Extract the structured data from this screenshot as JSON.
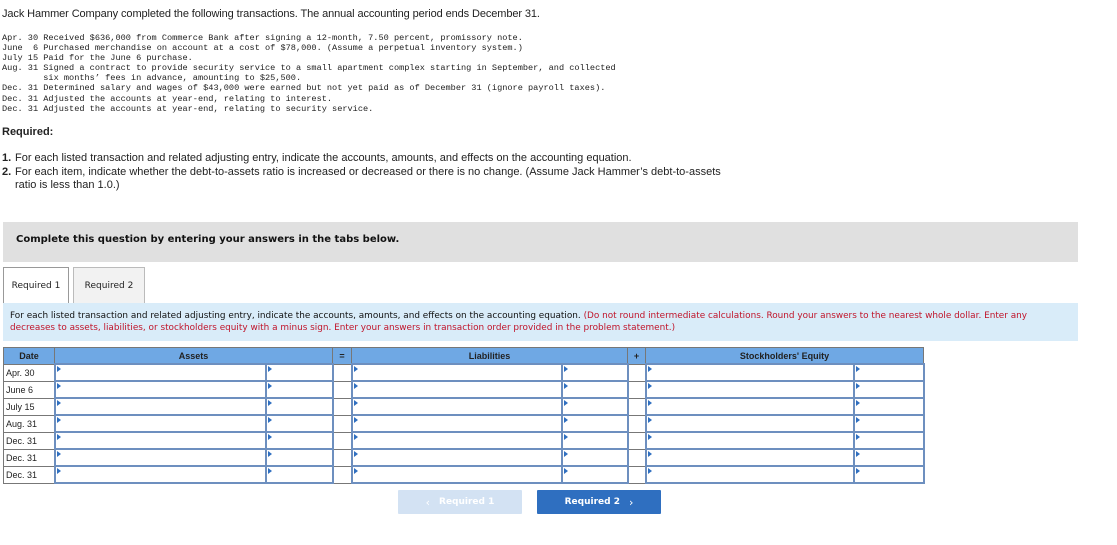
{
  "intro": "Jack Hammer Company completed the following transactions. The annual accounting period ends December 31.",
  "transactions": [
    "Apr. 30 Received $636,000 from Commerce Bank after signing a 12-month, 7.50 percent, promissory note.",
    "June  6 Purchased merchandise on account at a cost of $78,000. (Assume a perpetual inventory system.)",
    "July 15 Paid for the June 6 purchase.",
    "Aug. 31 Signed a contract to provide security service to a small apartment complex starting in September, and collected\n        six months’ fees in advance, amounting to $25,500.",
    "Dec. 31 Determined salary and wages of $43,000 were earned but not yet paid as of December 31 (ignore payroll taxes).",
    "Dec. 31 Adjusted the accounts at year-end, relating to interest.",
    "Dec. 31 Adjusted the accounts at year-end, relating to security service."
  ],
  "required": {
    "title": "Required:",
    "items": [
      {
        "num": "1.",
        "text": "For each listed transaction and related adjusting entry, indicate the accounts, amounts, and effects on the accounting equation."
      },
      {
        "num": "2.",
        "text": "For each item, indicate whether the debt-to-assets ratio is increased or decreased or there is no change. (Assume Jack Hammer’s debt-to-assets ratio is less than 1.0.)"
      }
    ]
  },
  "banner": "Complete this question by entering your answers in the tabs below.",
  "tabs": [
    {
      "label": "Required 1",
      "active": true
    },
    {
      "label": "Required 2",
      "active": false
    }
  ],
  "instructions": {
    "main": "For each listed transaction and related adjusting entry, indicate the accounts, amounts, and effects on the accounting equation. ",
    "note": "(Do not round intermediate calculations. Round your answers to the nearest whole dollar. Enter any decreases to assets, liabilities, or stockholders equity with a minus sign. Enter your answers in transaction order provided in the problem statement.)"
  },
  "table": {
    "headers": {
      "date": "Date",
      "assets": "Assets",
      "equals": "=",
      "liabilities": "Liabilities",
      "plus": "+",
      "equity": "Stockholders' Equity"
    },
    "rows": [
      {
        "date": "Apr. 30"
      },
      {
        "date": "June 6"
      },
      {
        "date": "July 15"
      },
      {
        "date": "Aug. 31"
      },
      {
        "date": "Dec. 31"
      },
      {
        "date": "Dec. 31"
      },
      {
        "date": "Dec. 31"
      }
    ]
  },
  "nav": {
    "prev_label": "Required 1",
    "next_label": "Required 2",
    "prev_icon": "‹",
    "next_icon": "›",
    "prev_enabled": false
  }
}
